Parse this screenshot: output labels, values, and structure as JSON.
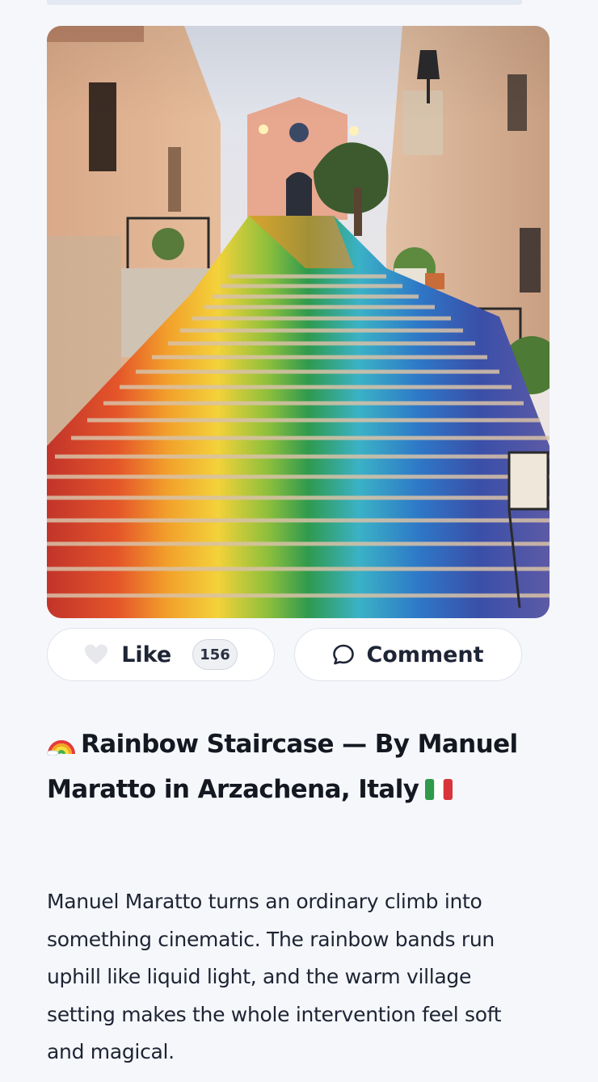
{
  "post": {
    "image_alt": "Rainbow painted staircase in Arzachena",
    "like_label": "Like",
    "like_count": "156",
    "comment_label": "Comment",
    "title_main": "Rainbow Staircase — By Manuel Maratto in Arzachena, Italy",
    "title_emoji_start": "rainbow-icon",
    "title_emoji_end": "italian-flag-icon",
    "body": "Manuel Maratto turns an ordinary climb into something cinematic. The rainbow bands run uphill like liquid light, and the warm village setting makes the whole intervention feel soft and magical."
  },
  "colors": {
    "background": "#f5f7fb",
    "button_border": "#dfe4ec",
    "text_dark": "#141821"
  }
}
